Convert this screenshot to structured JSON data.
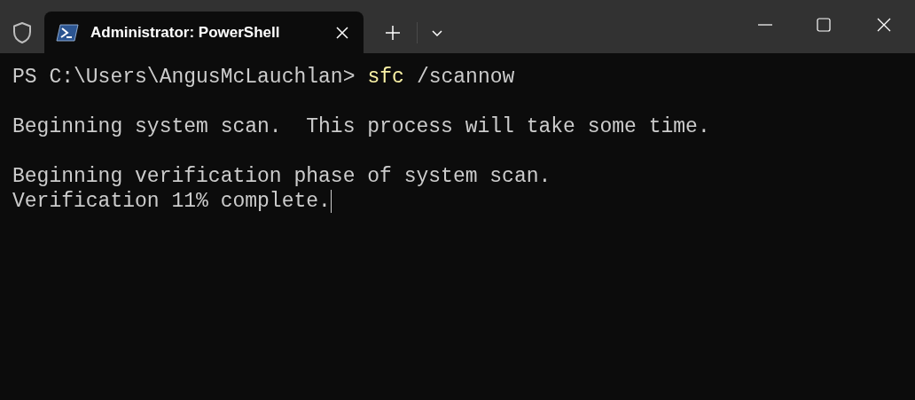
{
  "tab": {
    "title": "Administrator: PowerShell",
    "selected": true
  },
  "terminal": {
    "lines": [
      {
        "kind": "prompt",
        "prompt": "PS C:\\Users\\AngusMcLauchlan>",
        "command": "sfc",
        "args": "/scannow"
      },
      {
        "kind": "blank"
      },
      {
        "kind": "output",
        "text": "Beginning system scan.  This process will take some time."
      },
      {
        "kind": "blank"
      },
      {
        "kind": "output",
        "text": "Beginning verification phase of system scan."
      },
      {
        "kind": "output",
        "text": "Verification 11% complete.",
        "cursor": true
      }
    ]
  }
}
